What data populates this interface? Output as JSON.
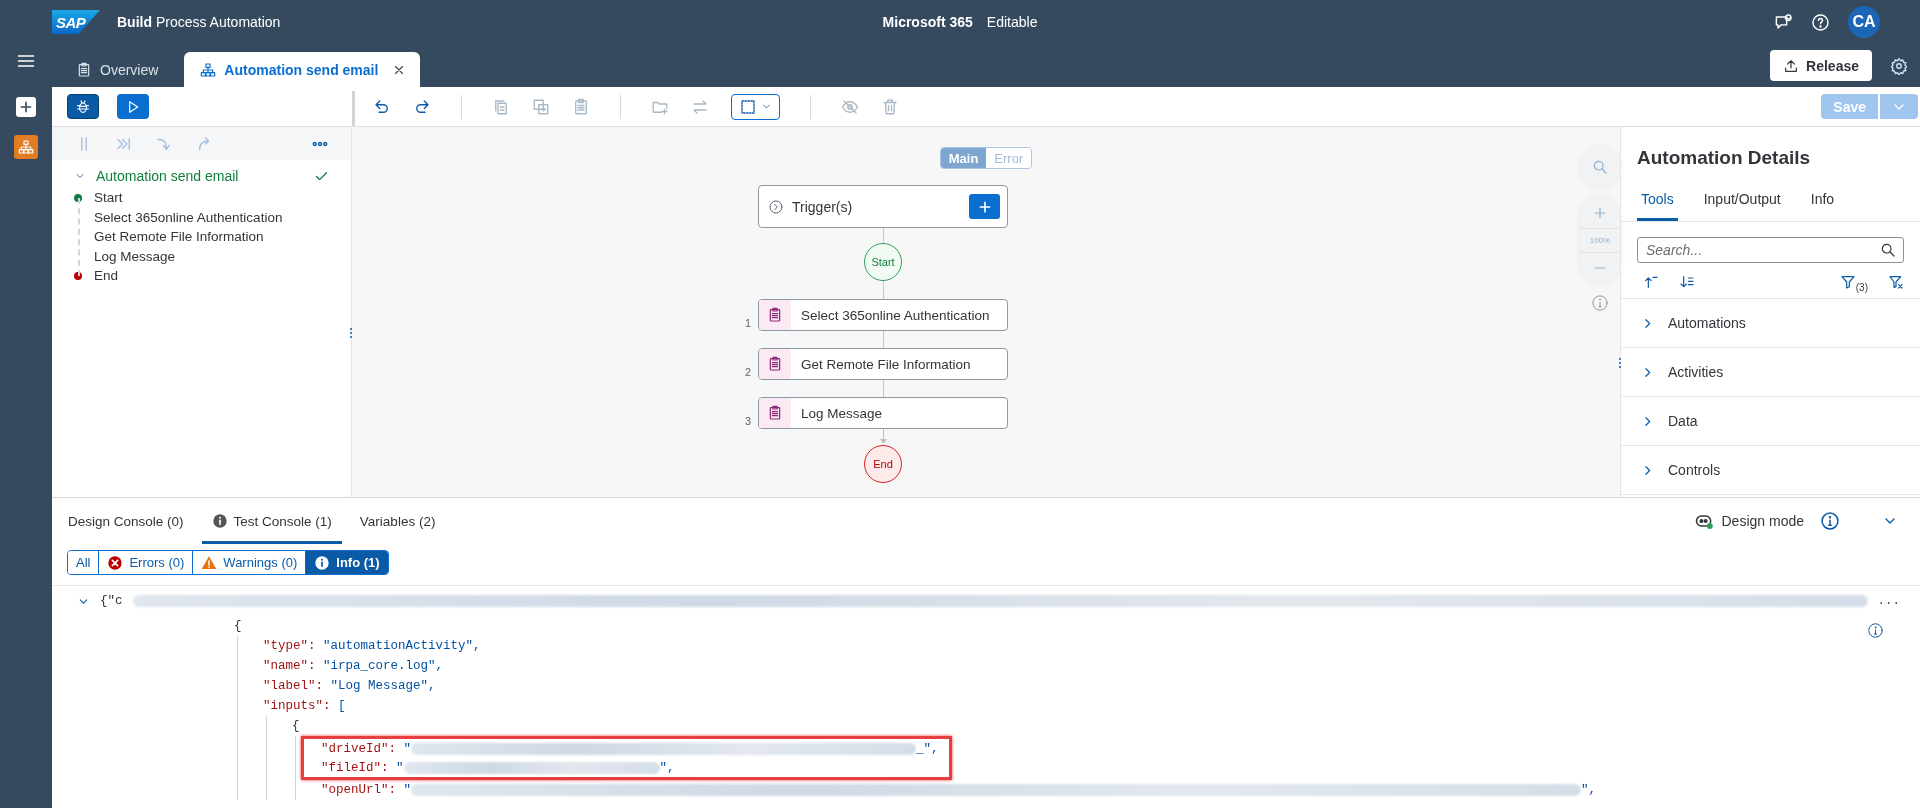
{
  "shell": {
    "logo": "SAP",
    "product_bold": "Build",
    "product": "Process Automation",
    "project": "Microsoft 365",
    "mode": "Editable",
    "avatar": "CA"
  },
  "tabs": [
    {
      "label": "Overview",
      "kind": "overview",
      "selected": false,
      "closable": false
    },
    {
      "label": "Automation send email",
      "kind": "automation",
      "selected": true,
      "closable": true
    }
  ],
  "release_button": "Release",
  "save": {
    "label": "Save",
    "disabled": true
  },
  "outline": {
    "title": "Automation send email",
    "expanded": true,
    "valid": true,
    "steps": [
      {
        "label": "Start",
        "kind": "start"
      },
      {
        "label": "Select 365online Authentication",
        "kind": "activity"
      },
      {
        "label": "Get Remote File Information",
        "kind": "activity"
      },
      {
        "label": "Log Message",
        "kind": "activity"
      },
      {
        "label": "End",
        "kind": "end"
      }
    ]
  },
  "flow": {
    "switch": [
      {
        "label": "Main",
        "selected": true
      },
      {
        "label": "Error",
        "selected": false
      }
    ],
    "trigger": "Trigger(s)",
    "start": "Start",
    "end": "End",
    "zoom_level": "100%",
    "steps": [
      {
        "number": "1",
        "label": "Select 365online Authentication"
      },
      {
        "number": "2",
        "label": "Get Remote File Information"
      },
      {
        "number": "3",
        "label": "Log Message"
      }
    ]
  },
  "details": {
    "title": "Automation Details",
    "tabs": [
      {
        "label": "Tools",
        "selected": true
      },
      {
        "label": "Input/Output",
        "selected": false
      },
      {
        "label": "Info",
        "selected": false
      }
    ],
    "search": {
      "placeholder": "Search..."
    },
    "filter_count": "(3)",
    "sections": [
      {
        "label": "Automations",
        "expanded": false
      },
      {
        "label": "Activities",
        "expanded": false
      },
      {
        "label": "Data",
        "expanded": false
      },
      {
        "label": "Controls",
        "expanded": false
      }
    ]
  },
  "console": {
    "tabs": [
      {
        "label": "Design Console (0)",
        "selected": false
      },
      {
        "label": "Test Console (1)",
        "kind": "test",
        "selected": true
      },
      {
        "label": "Variables (2)",
        "selected": false
      }
    ],
    "design_mode": "Design mode",
    "filters": [
      {
        "label": "All",
        "kind": "all",
        "selected": false
      },
      {
        "label": "Errors (0)",
        "kind": "error",
        "selected": false
      },
      {
        "label": "Warnings (0)",
        "kind": "warning",
        "selected": false
      },
      {
        "label": "Info (1)",
        "kind": "info",
        "selected": true
      }
    ],
    "log": {
      "expanded": true,
      "summary": "{\"c",
      "redacted": true,
      "ellipsis": "...",
      "code": [
        {
          "text": "{",
          "children": [
            {
              "key": "\"type\": ",
              "value": "\"automationActivity\","
            },
            {
              "key": "\"name\": ",
              "value": "\"irpa_core.log\","
            },
            {
              "key": "\"label\": ",
              "value": "\"Log Message\","
            },
            {
              "key": "\"inputs\": ",
              "value": "[",
              "children": [
                {
                  "text": "{",
                  "children": [
                    {
                      "key": "\"driveId\": ",
                      "value": "\"",
                      "redacted": true,
                      "tail": "_\",",
                      "highlighted": true
                    },
                    {
                      "key": "\"fileId\": ",
                      "value": "\"",
                      "redacted": true,
                      "tail": "\",",
                      "highlighted": true
                    },
                    {
                      "key": "\"openUrl\": ",
                      "value": "\"",
                      "redacted": true,
                      "tail": "\",",
                      "highlighted": false
                    }
                  ]
                }
              ]
            }
          ]
        }
      ]
    }
  }
}
